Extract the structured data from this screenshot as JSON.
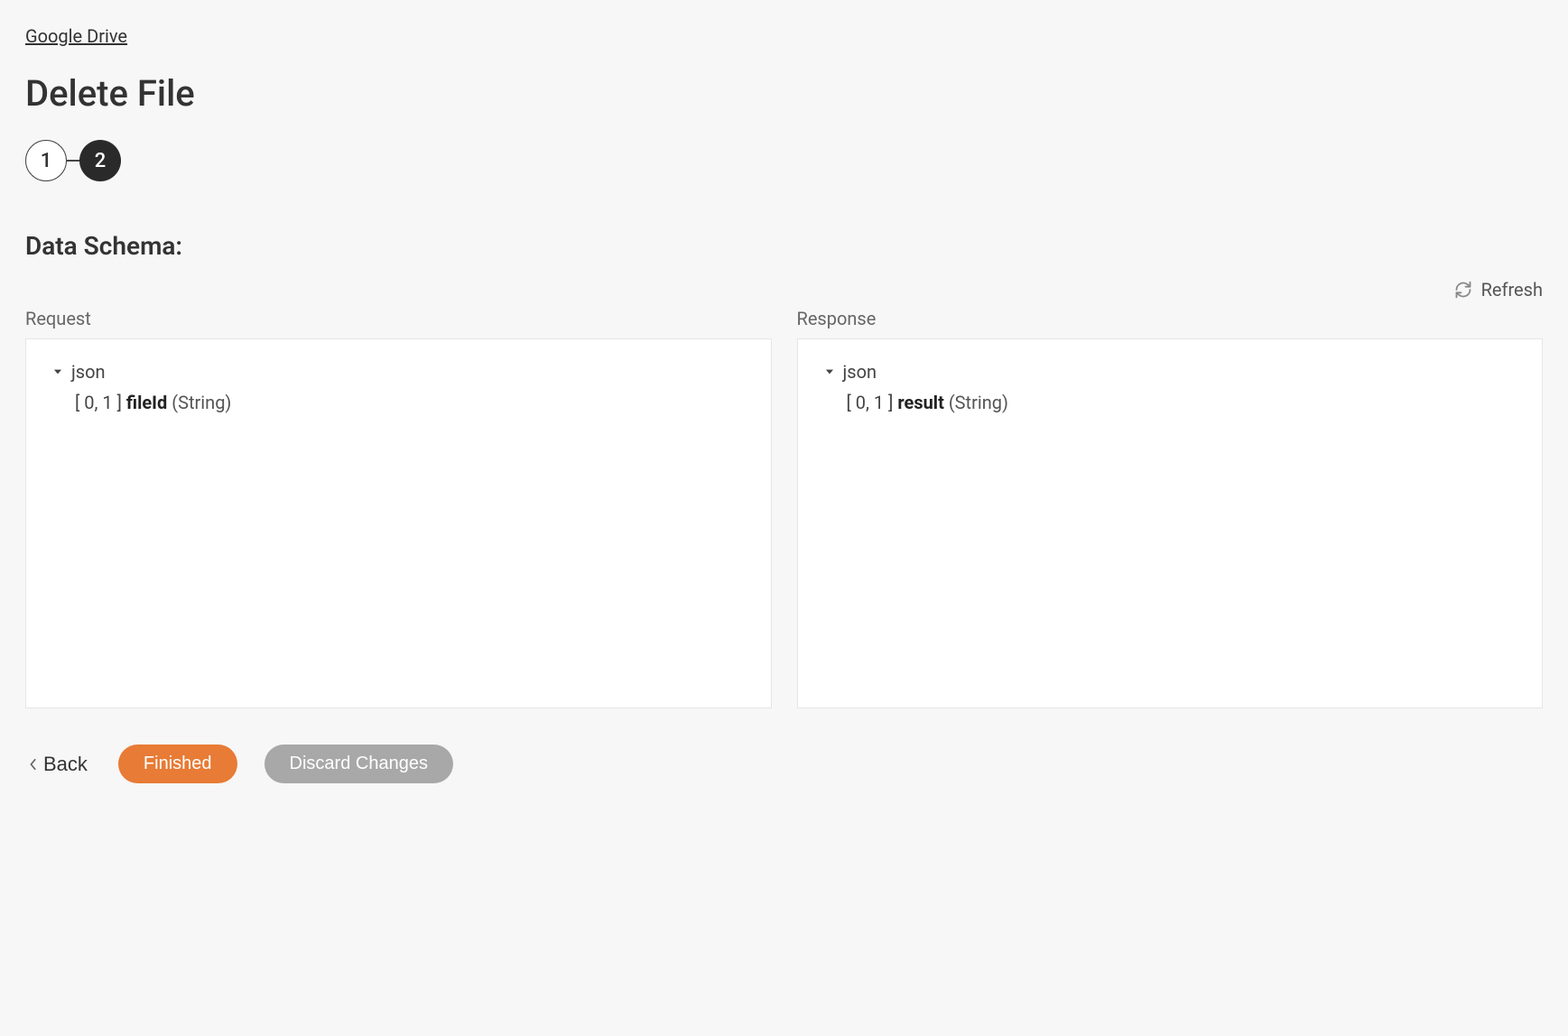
{
  "breadcrumb": "Google Drive",
  "page_title": "Delete File",
  "stepper": {
    "step1": "1",
    "step2": "2"
  },
  "section_title": "Data Schema:",
  "refresh_label": "Refresh",
  "request": {
    "label": "Request",
    "root": "json",
    "field_prefix": "[ 0, 1 ] ",
    "field_name": "fileId",
    "field_type": " (String)"
  },
  "response": {
    "label": "Response",
    "root": "json",
    "field_prefix": "[ 0, 1 ] ",
    "field_name": "result",
    "field_type": " (String)"
  },
  "buttons": {
    "back": "Back",
    "finished": "Finished",
    "discard": "Discard Changes"
  }
}
